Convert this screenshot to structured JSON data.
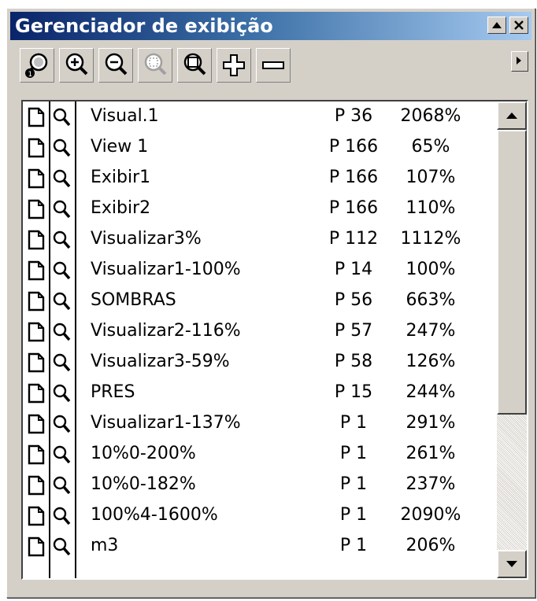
{
  "window": {
    "title": "Gerenciador de exibição",
    "title_color": "#ffffff",
    "titlebar_gradient": [
      "#0a246a",
      "#a6caf0"
    ]
  },
  "title_buttons": [
    "minimize-icon",
    "close-icon"
  ],
  "toolbar": {
    "tools": [
      "new-view-icon",
      "zoom-in-icon",
      "zoom-out-icon",
      "zoom-to-selection-icon",
      "zoom-to-fit-icon",
      "add-view-icon",
      "delete-view-icon"
    ],
    "more_button": "flyout-arrow-icon"
  },
  "views": [
    {
      "name": "Visual.1",
      "page": "P 36",
      "zoom": "2068%"
    },
    {
      "name": "View 1",
      "page": "P 166",
      "zoom": "65%"
    },
    {
      "name": "Exibir1",
      "page": "P 166",
      "zoom": "107%"
    },
    {
      "name": "Exibir2",
      "page": "P 166",
      "zoom": "110%"
    },
    {
      "name": "Visualizar3%",
      "page": "P 112",
      "zoom": "1112%"
    },
    {
      "name": "Visualizar1-100%",
      "page": "P 14",
      "zoom": "100%"
    },
    {
      "name": "SOMBRAS",
      "page": "P 56",
      "zoom": "663%"
    },
    {
      "name": "Visualizar2-116%",
      "page": "P 57",
      "zoom": "247%"
    },
    {
      "name": "Visualizar3-59%",
      "page": "P 58",
      "zoom": "126%"
    },
    {
      "name": "PRES",
      "page": "P 15",
      "zoom": "244%"
    },
    {
      "name": "Visualizar1-137%",
      "page": "P 1",
      "zoom": "291%"
    },
    {
      "name": "10%0-200%",
      "page": "P 1",
      "zoom": "261%"
    },
    {
      "name": "10%0-182%",
      "page": "P 1",
      "zoom": "237%"
    },
    {
      "name": "100%4-1600%",
      "page": "P 1",
      "zoom": "2090%"
    },
    {
      "name": "m3",
      "page": "P 1",
      "zoom": "206%"
    }
  ],
  "row_icons": {
    "page": "page-icon",
    "zoom": "magnifier-icon"
  },
  "scrollbar": {
    "position": 0.0,
    "visible_fraction": 0.66
  }
}
